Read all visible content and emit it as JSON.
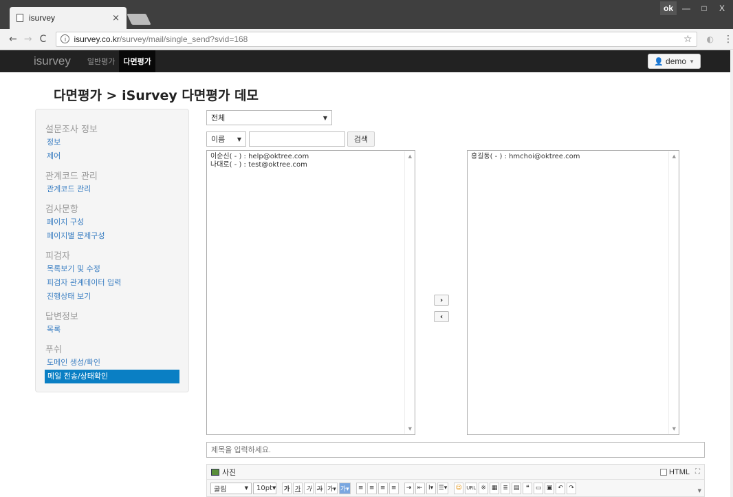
{
  "browser": {
    "tab_title": "isurvey",
    "tab_close": "×",
    "url_host": "isurvey.co.kr",
    "url_path": "/survey/mail/single_send?svid=168",
    "window_badge": "ok",
    "minimize": "—",
    "maximize": "□",
    "close": "X"
  },
  "navbar": {
    "brand": "isurvey",
    "links": [
      "일반평가",
      "다면평가"
    ],
    "active_link": "다면평가",
    "user": "demo"
  },
  "page": {
    "title": "다면평가 > iSurvey 다면평가 데모"
  },
  "sidebar": {
    "sections": [
      {
        "header": "설문조사 정보",
        "items": [
          "정보",
          "제어"
        ]
      },
      {
        "header": "관계코드 관리",
        "items": [
          "관계코드 관리"
        ]
      },
      {
        "header": "검사문항",
        "items": [
          "페이지 구성",
          "페이지별 문제구성"
        ]
      },
      {
        "header": "피검자",
        "items": [
          "목록보기 및 수정",
          "피검자 관계데이터 입력",
          "진행상태 보기"
        ]
      },
      {
        "header": "답변정보",
        "items": [
          "목록"
        ]
      },
      {
        "header": "푸쉬",
        "items": [
          "도메인 생성/확인",
          "메일 전송/상태확인"
        ]
      }
    ],
    "active_item": "메일 전송/상태확인"
  },
  "filter": {
    "group_select": "전체",
    "field_select": "이름",
    "search_value": "",
    "search_button": "검색"
  },
  "lists": {
    "available": [
      "이순신( - ) : help@oktree.com",
      "나대로( - ) : test@oktree.com"
    ],
    "selected": [
      "홍길동( - ) : hmchoi@oktree.com"
    ]
  },
  "move": {
    "right": "›",
    "left": "‹"
  },
  "mail": {
    "subject_placeholder": "제목을 입력하세요.",
    "photo_label": "사진",
    "html_label": "HTML",
    "font_select": "굴림",
    "size_select": "10pt"
  },
  "icons": {
    "browser": [
      "page-icon",
      "info-icon",
      "star-icon",
      "extension-icon",
      "menu-icon"
    ],
    "editor": [
      "photo-icon",
      "expand-icon",
      "emoji-icon",
      "url-icon",
      "table-icon",
      "quote-icon",
      "undo-icon",
      "redo-icon"
    ]
  }
}
